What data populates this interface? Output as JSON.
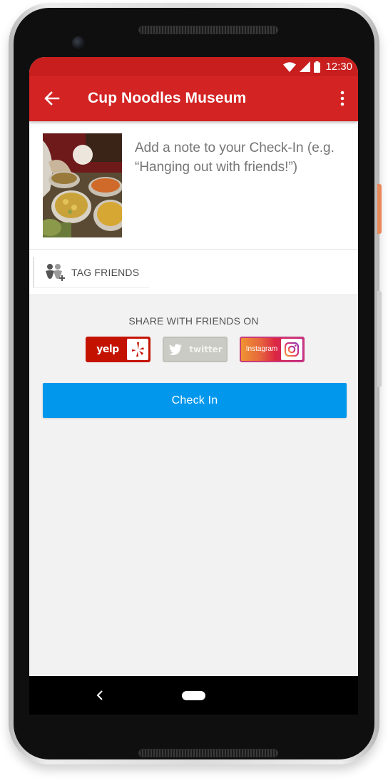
{
  "status_bar": {
    "time": "12:30"
  },
  "app_bar": {
    "title": "Cup Noodles Museum"
  },
  "note": {
    "placeholder": "Add a note to your Check-In (e.g. “Hanging out with friends!”)"
  },
  "tag": {
    "label": "TAG FRIENDS"
  },
  "share": {
    "title": "SHARE WITH FRIENDS ON",
    "yelp_label": "yelp",
    "twitter_label": "twitter",
    "instagram_label": "Instagram"
  },
  "checkin": {
    "label": "Check In"
  },
  "colors": {
    "brand_red": "#d32323",
    "status_red": "#c81e1e",
    "checkin_blue": "#0097ec",
    "yelp_red": "#c41200"
  }
}
